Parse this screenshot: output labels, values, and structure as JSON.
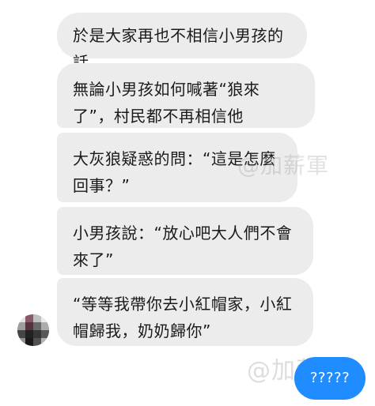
{
  "conversation": {
    "incoming_messages": [
      {
        "text": "於是大家再也不相信小男孩的話"
      },
      {
        "text": "無論小男孩如何喊著“狼來了”，村民都不再相信他"
      },
      {
        "text": "大灰狼疑惑的問：“這是怎麼回事？”"
      },
      {
        "text": "小男孩說：“放心吧大人們不會來了”"
      },
      {
        "text": "“等等我帶你去小紅帽家，小紅帽歸我，奶奶歸你”"
      }
    ],
    "outgoing_message": {
      "text": "?????"
    }
  },
  "watermark": {
    "text_1": "@加薪軍",
    "text_2": "@加薪軍"
  },
  "colors": {
    "incoming_bubble": "#ececec",
    "outgoing_bubble": "#1f8cff",
    "background": "#ffffff"
  }
}
